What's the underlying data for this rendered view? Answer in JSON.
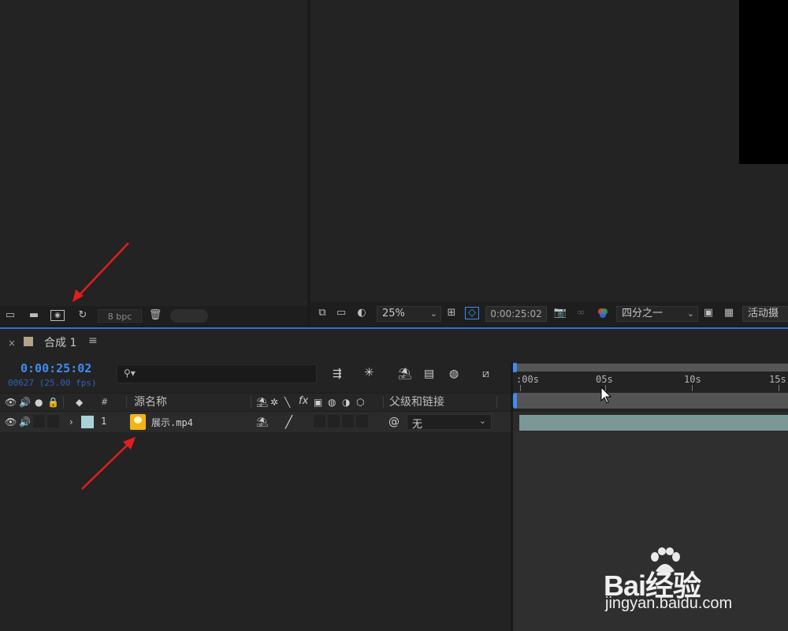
{
  "project_panel": {
    "bpc_label": "8 bpc",
    "icons": [
      "interpret-footage-icon",
      "new-folder-icon",
      "new-composition-icon",
      "flowchart-icon",
      "trash-icon"
    ]
  },
  "viewer": {
    "zoom": "25%",
    "timecode": "0:00:25:02",
    "resolution": "四分之一",
    "camera": "活动摄"
  },
  "composition": {
    "close_glyph": "×",
    "tab_name": "合成 1",
    "menu_glyph": "≡",
    "tab_color": "#b4a289"
  },
  "timeline": {
    "current_time": "0:00:25:02",
    "frame_info": "00627 (25.00 fps)",
    "search_glyph": "⚲▾",
    "columns": {
      "hash": "#",
      "source_name": "源名称",
      "parent_link": "父级和链接",
      "fx": "fx"
    },
    "ruler_ticks": [
      ":00s",
      "05s",
      "10s",
      "15s"
    ]
  },
  "layers": [
    {
      "number": "1",
      "name": "展示.mp4",
      "parent": "无",
      "label_color": "#a9d2d8",
      "bar_color": "#7b9796"
    }
  ],
  "watermark": {
    "brand": "Bai经验",
    "url": "jingyan.baidu.com"
  }
}
